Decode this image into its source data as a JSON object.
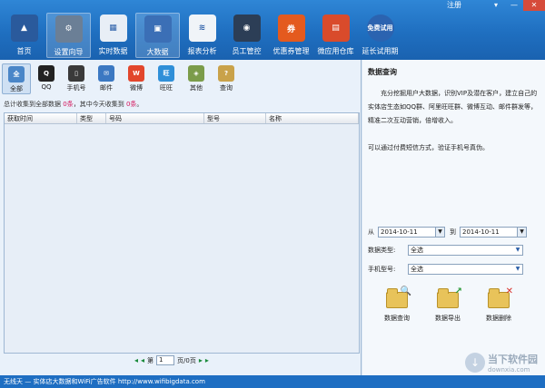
{
  "window": {
    "register": "注册",
    "min": "—",
    "max": "□",
    "close": "✕",
    "menu": "▾"
  },
  "toolbar": [
    {
      "name": "home",
      "label": "首页",
      "icon": "home-chart-icon",
      "text": "▲",
      "color": "#2a5a9c"
    },
    {
      "name": "setup-wizard",
      "label": "设置向导",
      "icon": "wizard-icon",
      "text": "⚙",
      "color": "#6b7f96"
    },
    {
      "name": "realtime-data",
      "label": "实时数据",
      "icon": "table-icon",
      "text": "▦",
      "color": "#e8eef6"
    },
    {
      "name": "big-data",
      "label": "大数据",
      "icon": "monitor-icon",
      "text": "▣",
      "color": "#3b6fb6"
    },
    {
      "name": "report-analysis",
      "label": "报表分析",
      "icon": "report-icon",
      "text": "≋",
      "color": "#f0f4f8"
    },
    {
      "name": "staff-control",
      "label": "员工管控",
      "icon": "camera-icon",
      "text": "◉",
      "color": "#2c3e56"
    },
    {
      "name": "coupon-management",
      "label": "优惠券管理",
      "icon": "coupon-icon",
      "text": "券",
      "color": "#e45a1e"
    },
    {
      "name": "micro-app-store",
      "label": "微应用仓库",
      "icon": "gift-icon",
      "text": "▤",
      "color": "#d94b2b"
    },
    {
      "name": "extend-trial",
      "label": "延长试用期",
      "icon": "free-trial-icon",
      "text": "免费试用",
      "color": "#2b63b0"
    }
  ],
  "categories": [
    {
      "name": "all",
      "label": "全部",
      "text": "全",
      "color": "#4a86c8"
    },
    {
      "name": "qq",
      "label": "QQ",
      "text": "Q",
      "color": "#222222"
    },
    {
      "name": "phone",
      "label": "手机号",
      "text": "▯",
      "color": "#3a3a3a"
    },
    {
      "name": "email",
      "label": "邮件",
      "text": "✉",
      "color": "#3b78c2"
    },
    {
      "name": "weibo",
      "label": "微博",
      "text": "W",
      "color": "#e2462c"
    },
    {
      "name": "wangwang",
      "label": "旺旺",
      "text": "旺",
      "color": "#2f8fd8"
    },
    {
      "name": "other",
      "label": "其他",
      "text": "◈",
      "color": "#7b9c4a"
    },
    {
      "name": "query",
      "label": "查询",
      "text": "?",
      "color": "#c9a24a"
    }
  ],
  "summary": {
    "prefix": "总计收集到全部数据 ",
    "total": "0条",
    "middle": "，其中今天收集到 ",
    "today": "0条",
    "suffix": "。"
  },
  "grid": {
    "columns": [
      {
        "label": "获取时间",
        "w": 80
      },
      {
        "label": "类型",
        "w": 32
      },
      {
        "label": "号码",
        "w": 108
      },
      {
        "label": "型号",
        "w": 68
      },
      {
        "label": "名称",
        "w": 102
      }
    ]
  },
  "pager": {
    "first": "◂",
    "prev": "◂",
    "page_prefix": "第",
    "page_value": "1",
    "page_suffix": "页/0页",
    "next": "▸",
    "last": "▸"
  },
  "right": {
    "title": "数据查询",
    "desc": "充分挖掘用户大数据，识别VIP及潜在客户，建立自己的实体店生态如QQ群、阿里旺旺群、微博互动、邮件群发等，精准二次互动营销，倍增收入。",
    "note": "可以通过付费短信方式，验证手机号真伪。",
    "from_label": "从",
    "from_date": "2014-10-11",
    "to_label": "到",
    "to_date": "2014-10-11",
    "type_label": "数据类型:",
    "type_value": "全选",
    "model_label": "手机型号:",
    "model_value": "全选",
    "actions": [
      {
        "name": "query",
        "label": "数据查询",
        "badge": "🔍",
        "badge_color": "#3a6fb8"
      },
      {
        "name": "export",
        "label": "数据导出",
        "badge": "↗",
        "badge_color": "#2e9b3c"
      },
      {
        "name": "delete",
        "label": "数据删除",
        "badge": "✕",
        "badge_color": "#d8302a"
      }
    ]
  },
  "status": "无线天 — 实体店大数据和WiFi广告软件    http://www.wifibigdata.com",
  "watermark": {
    "title": "当下软件园",
    "url": "downxia.com"
  }
}
